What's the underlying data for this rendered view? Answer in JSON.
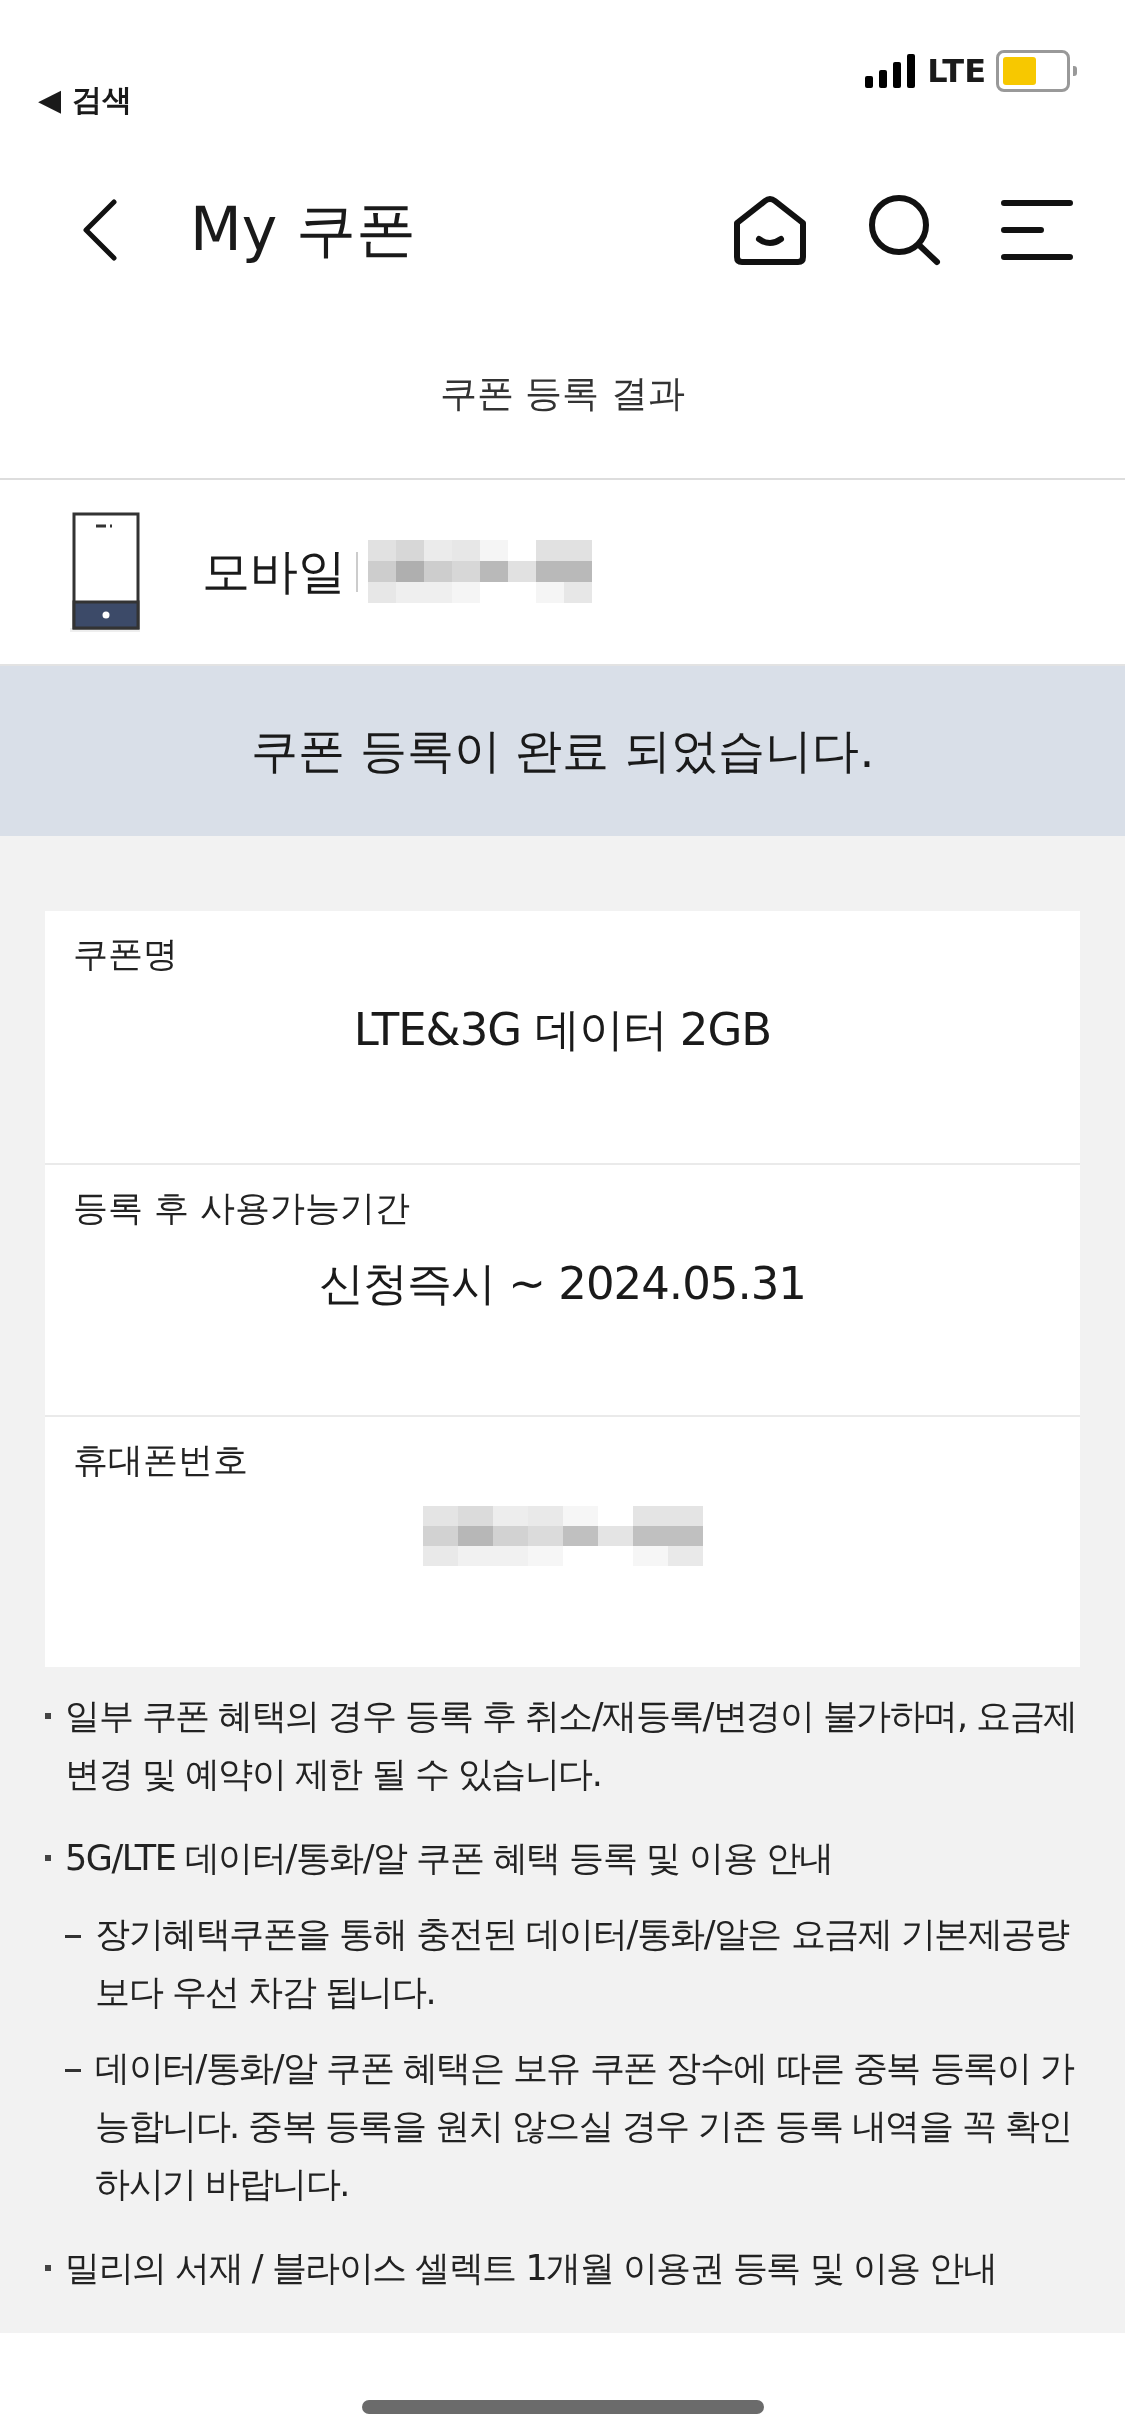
{
  "status_bar": {
    "back_label": "◀ 검색",
    "network": "LTE"
  },
  "header": {
    "title": "My 쿠폰"
  },
  "subtitle": "쿠폰 등록 결과",
  "line": {
    "label": "모바일"
  },
  "banner": "쿠폰 등록이 완료 되었습니다.",
  "details": [
    {
      "label": "쿠폰명",
      "value": "LTE&3G 데이터 2GB"
    },
    {
      "label": "등록 후 사용가능기간",
      "value": "신청즉시 ~ 2024.05.31"
    },
    {
      "label": "휴대폰번호",
      "kind": "blurred"
    }
  ],
  "notes": [
    {
      "text": "일부 쿠폰 혜택의 경우 등록 후 취소/재등록/변경이 불가하며, 요금제 변경 및 예약이 제한 될 수 있습니다."
    },
    {
      "text": "5G/LTE 데이터/통화/알 쿠폰 혜택 등록 및 이용 안내",
      "children": [
        {
          "text": "장기혜택쿠폰을 통해 충전된 데이터/통화/알은 요금제 기본제공량 보다 우선 차감 됩니다."
        },
        {
          "text": "데이터/통화/알 쿠폰 혜택은 보유 쿠폰 장수에 따른 중복 등록이 가능합니다. 중복 등록을 원치 않으실 경우 기존 등록 내역을 꼭 확인 하시기 바랍니다."
        }
      ]
    },
    {
      "text": "밀리의 서재 / 블라이스 셀렉트 1개월 이용권 등록 및 이용 안내"
    }
  ]
}
